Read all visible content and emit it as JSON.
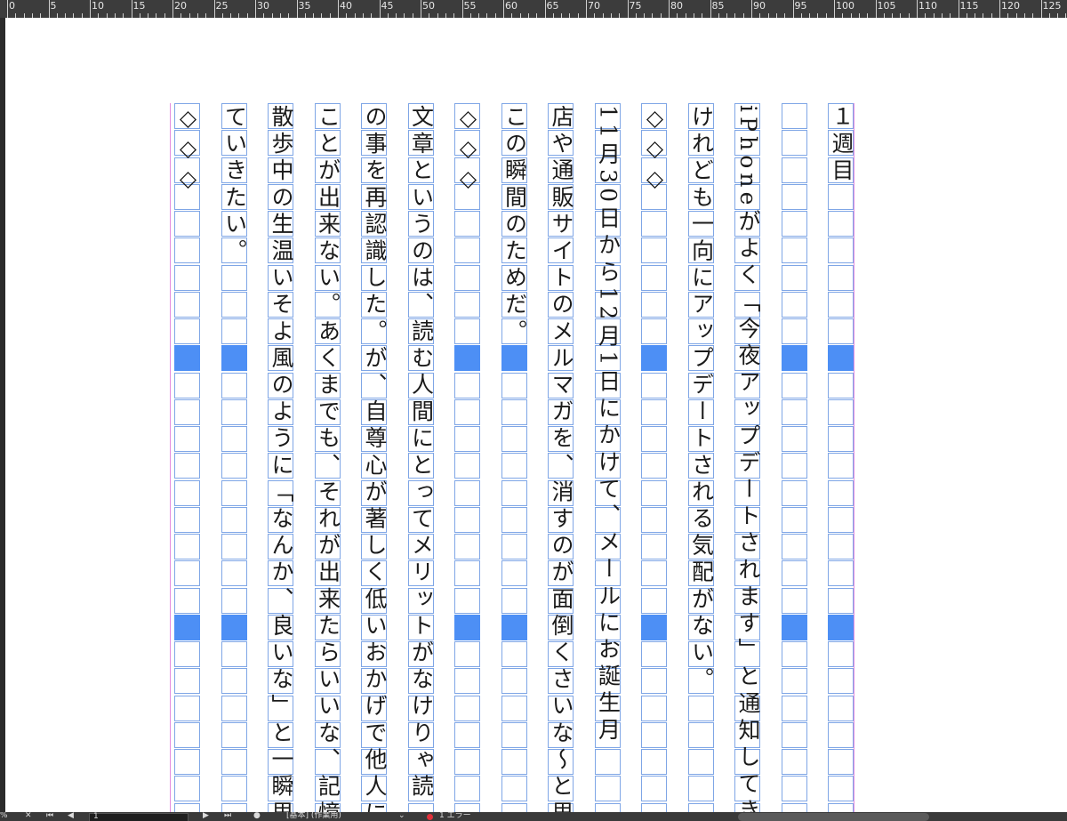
{
  "ruler": {
    "labels": [
      "0",
      "5",
      "10",
      "15",
      "20",
      "25",
      "30",
      "35",
      "40",
      "45",
      "50",
      "55",
      "60",
      "65",
      "70",
      "75",
      "80",
      "85",
      "90",
      "95",
      "100",
      "105",
      "110",
      "115",
      "120",
      "125"
    ]
  },
  "manuscript": {
    "columns": [
      {
        "text": "１週目",
        "highlight": true
      },
      {
        "text": "",
        "highlight": true
      },
      {
        "text": "iPhoneがよく「今夜アップデートされます」と通知してき",
        "highlight": false
      },
      {
        "text": "けれども一向にアップデートされる気配がない。",
        "highlight": false
      },
      {
        "text": "◇◇◇",
        "highlight": true
      },
      {
        "text": "11月30日から12月1日にかけて、メールにお誕生月",
        "highlight": false
      },
      {
        "text": "店や通販サイトのメルマガを、消すのが面倒くさいな〜と思",
        "highlight": false
      },
      {
        "text": "この瞬間のためだ。",
        "highlight": true
      },
      {
        "text": "◇◇◇",
        "highlight": true
      },
      {
        "text": "文章というのは、読む人間にとってメリットがなけりゃ読",
        "highlight": false
      },
      {
        "text": "の事を再認識した。が、自尊心が著しく低いおかげで他人に",
        "highlight": false
      },
      {
        "text": "ことが出来ない。あくまでも、それが出来たらいいな、記憶",
        "highlight": false
      },
      {
        "text": "散歩中の生温いそよ風のように「なんか、良いな」と一瞬思",
        "highlight": false
      },
      {
        "text": "ていきたい。",
        "highlight": true
      },
      {
        "text": "◇◇◇",
        "highlight": true
      }
    ]
  },
  "statusbar": {
    "zoom": "%",
    "page_number": "1",
    "style_label": "[基本] (作業用)",
    "error_label": "1 エラー"
  }
}
